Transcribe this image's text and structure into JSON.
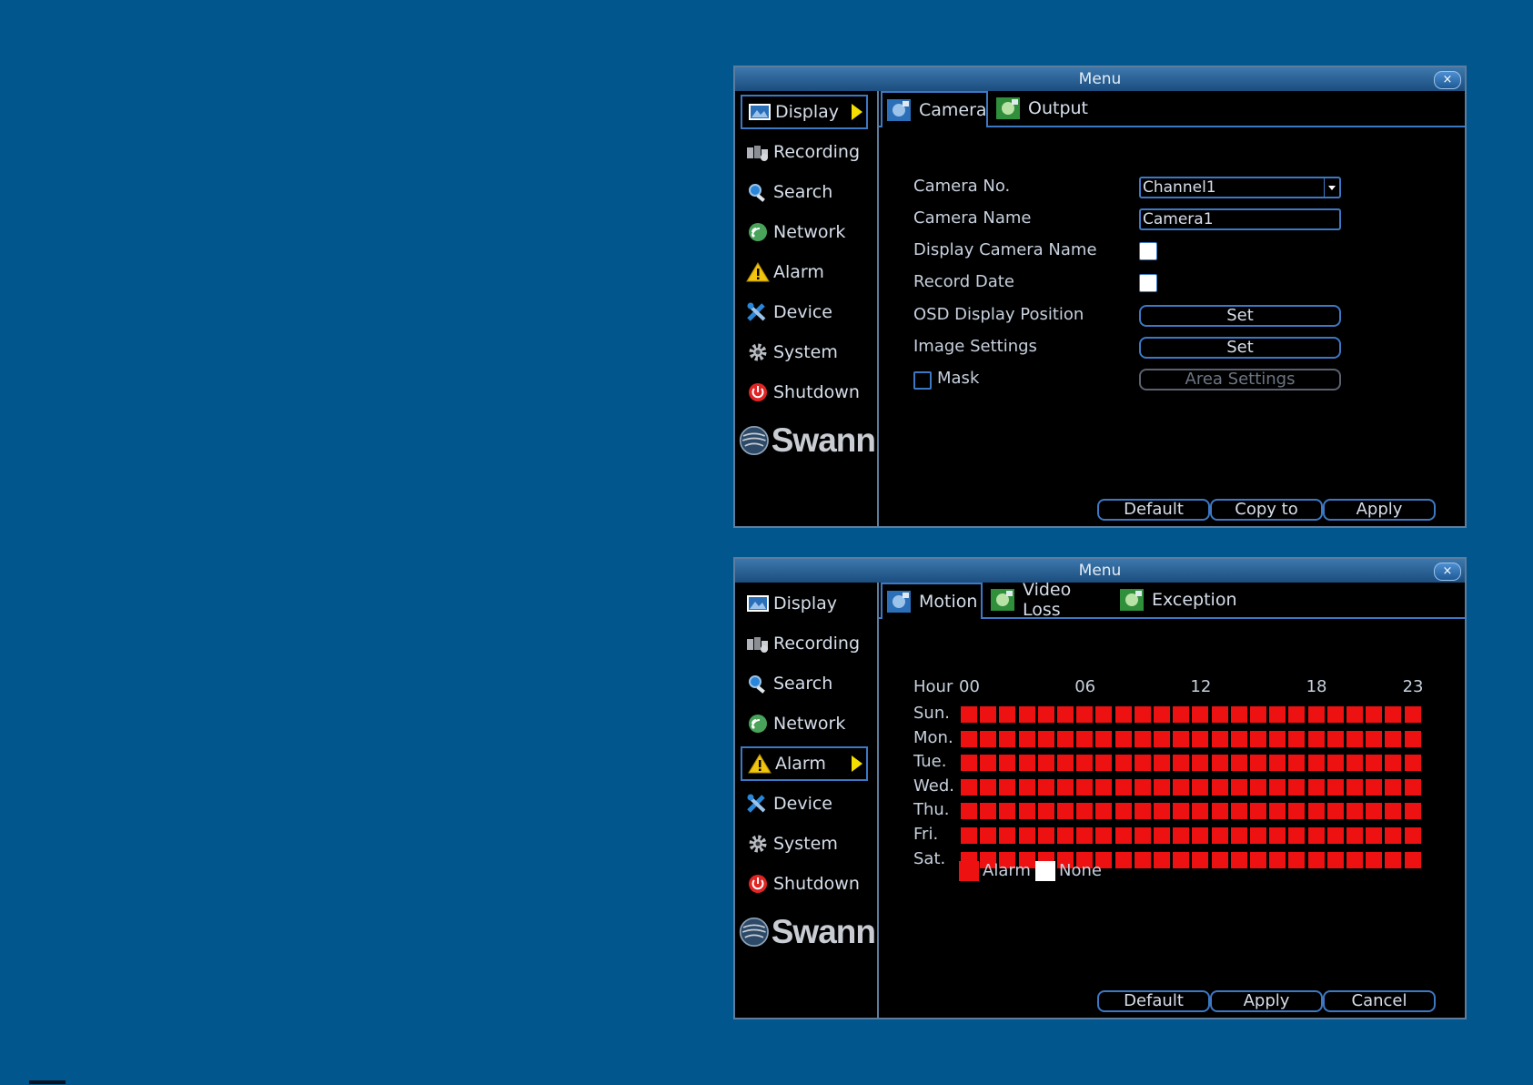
{
  "window1": {
    "title": "Menu",
    "close": "×",
    "sidebar": [
      {
        "label": "Display",
        "icon": "display-icon",
        "active": true
      },
      {
        "label": "Recording",
        "icon": "recording-icon",
        "active": false
      },
      {
        "label": "Search",
        "icon": "search-icon",
        "active": false
      },
      {
        "label": "Network",
        "icon": "network-icon",
        "active": false
      },
      {
        "label": "Alarm",
        "icon": "alarm-icon",
        "active": false
      },
      {
        "label": "Device",
        "icon": "device-icon",
        "active": false
      },
      {
        "label": "System",
        "icon": "system-icon",
        "active": false
      },
      {
        "label": "Shutdown",
        "icon": "shutdown-icon",
        "active": false
      }
    ],
    "logo": "Swann",
    "tabs": [
      {
        "label": "Camera",
        "active": true
      },
      {
        "label": "Output",
        "active": false
      }
    ],
    "form": {
      "camera_no_label": "Camera No.",
      "camera_no_value": "Channel1",
      "camera_name_label": "Camera Name",
      "camera_name_value": "Camera1",
      "display_camera_name_label": "Display Camera Name",
      "record_date_label": "Record Date",
      "osd_label": "OSD Display Position",
      "osd_button": "Set",
      "image_settings_label": "Image Settings",
      "image_settings_button": "Set",
      "mask_label": "Mask",
      "area_settings_button": "Area Settings"
    },
    "footer": {
      "default": "Default",
      "copy_to": "Copy to",
      "apply": "Apply"
    }
  },
  "window2": {
    "title": "Menu",
    "close": "×",
    "sidebar": [
      {
        "label": "Display",
        "icon": "display-icon",
        "active": false
      },
      {
        "label": "Recording",
        "icon": "recording-icon",
        "active": false
      },
      {
        "label": "Search",
        "icon": "search-icon",
        "active": false
      },
      {
        "label": "Network",
        "icon": "network-icon",
        "active": false
      },
      {
        "label": "Alarm",
        "icon": "alarm-icon",
        "active": true
      },
      {
        "label": "Device",
        "icon": "device-icon",
        "active": false
      },
      {
        "label": "System",
        "icon": "system-icon",
        "active": false
      },
      {
        "label": "Shutdown",
        "icon": "shutdown-icon",
        "active": false
      }
    ],
    "logo": "Swann",
    "tabs": [
      {
        "label": "Motion",
        "active": true
      },
      {
        "label": "Video Loss",
        "active": false
      },
      {
        "label": "Exception",
        "active": false
      }
    ],
    "schedule": {
      "hour_label": "Hour",
      "hour_ticks": [
        {
          "label": "00",
          "hour": 0
        },
        {
          "label": "06",
          "hour": 6
        },
        {
          "label": "12",
          "hour": 12
        },
        {
          "label": "18",
          "hour": 18
        },
        {
          "label": "23",
          "hour": 23
        }
      ],
      "days": [
        "Sun.",
        "Mon.",
        "Tue.",
        "Wed.",
        "Thu.",
        "Fri.",
        "Sat."
      ],
      "hours_per_day": 24,
      "state": "alarm",
      "alarm_color": "#ee1111",
      "none_color": "#ffffff"
    },
    "legend": {
      "alarm": "Alarm",
      "none": "None"
    },
    "footer": {
      "default": "Default",
      "apply": "Apply",
      "cancel": "Cancel"
    }
  }
}
